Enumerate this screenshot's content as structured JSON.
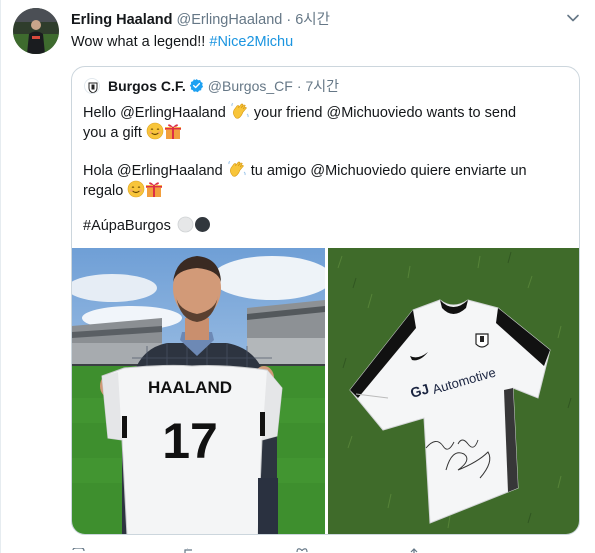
{
  "tweet": {
    "author_name": "Erling Haaland",
    "author_handle": "@ErlingHaaland",
    "separator": "·",
    "time": "6시간",
    "text_prefix": "Wow what a legend!! ",
    "hashtag": "#Nice2Michu"
  },
  "quoted": {
    "author_name": "Burgos C.F.",
    "author_handle": "@Burgos_CF",
    "separator": "·",
    "time": "7시간",
    "line1_a": "Hello @ErlingHaaland ",
    "line1_b": " your friend @Michuoviedo wants to send",
    "line2": "you a gift ",
    "line3_a": "Hola @ErlingHaaland ",
    "line3_b": " tu amigo @Michuoviedo quiere enviarte un",
    "line4": "regalo ",
    "hashtag": "#AúpaBurgos",
    "photo1": {
      "shirt_name": "HAALAND",
      "shirt_number": "17"
    },
    "photo2": {
      "sponsor": "Automotive",
      "sponsor_logo": "GJ"
    }
  },
  "icons": {
    "caret": "chevron-down-icon",
    "verified": "verified-badge-icon",
    "wave": "waving-hand-emoji",
    "smile": "smiling-face-emoji",
    "gift": "gift-emoji",
    "circle_white": "white-circle-emoji",
    "circle_black": "black-circle-emoji"
  },
  "colors": {
    "link": "#1b95e0",
    "verified": "#1da1f2",
    "secondary_text": "#657786",
    "border": "#ccd6dd"
  }
}
